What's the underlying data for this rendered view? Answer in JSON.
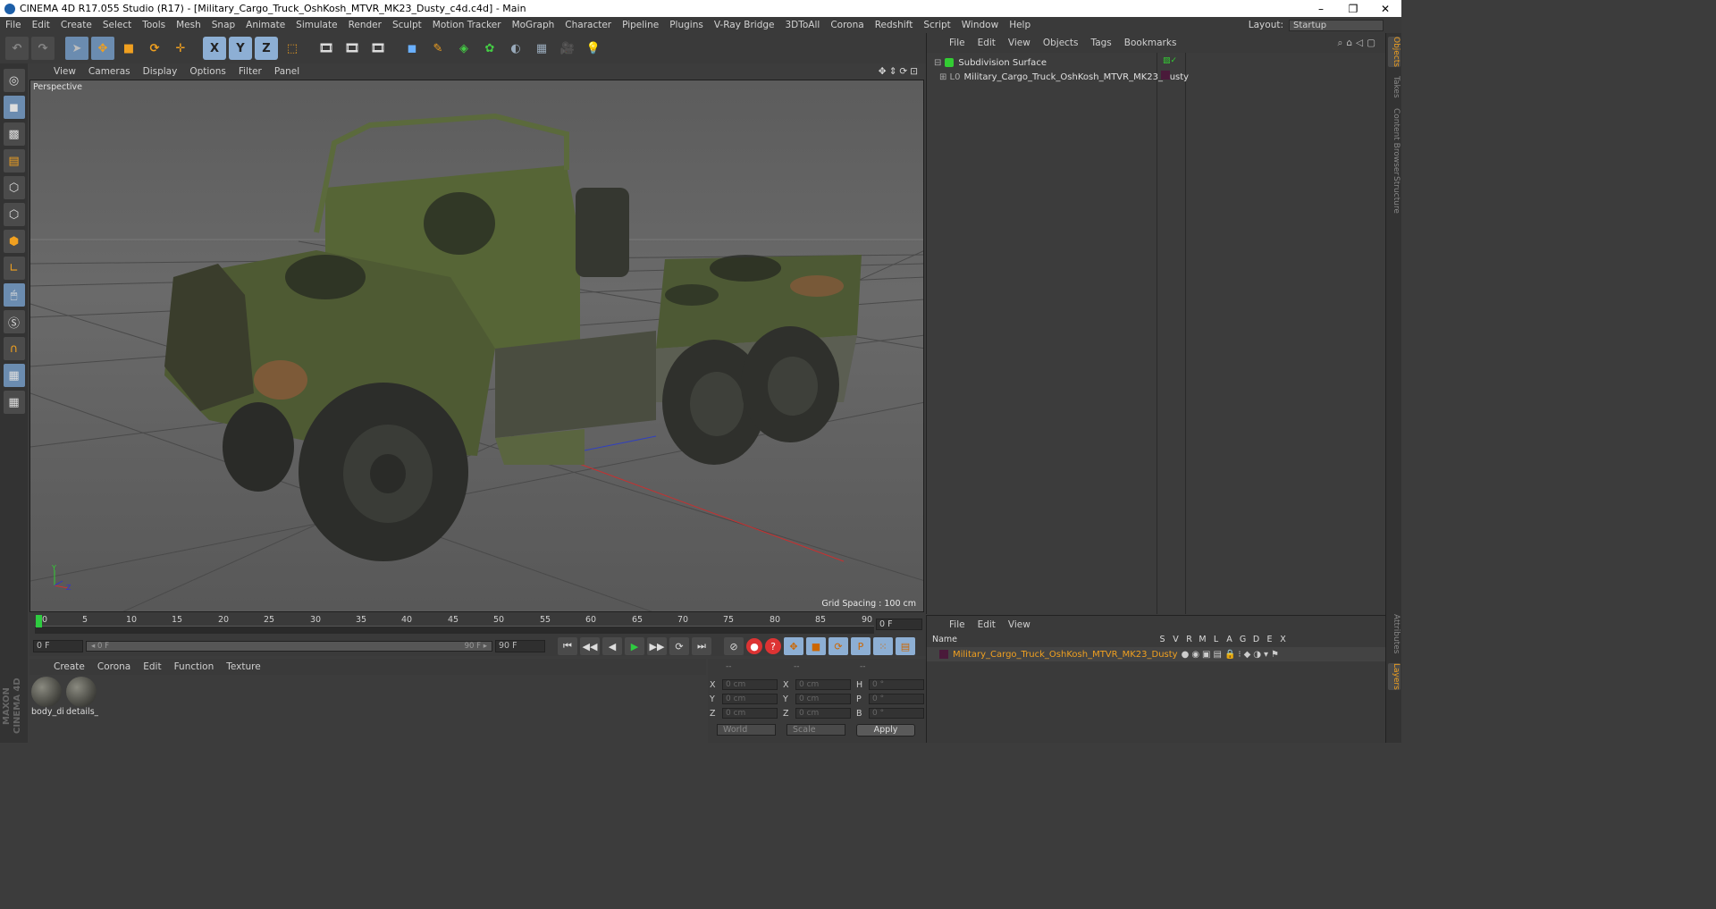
{
  "window": {
    "title": "CINEMA 4D R17.055 Studio (R17) - [Military_Cargo_Truck_OshKosh_MTVR_MK23_Dusty_c4d.c4d] - Main",
    "controls": [
      "–",
      "❐",
      "✕"
    ]
  },
  "menubar": {
    "items": [
      "File",
      "Edit",
      "Create",
      "Select",
      "Tools",
      "Mesh",
      "Snap",
      "Animate",
      "Simulate",
      "Render",
      "Sculpt",
      "Motion Tracker",
      "MoGraph",
      "Character",
      "Pipeline",
      "Plugins",
      "V-Ray Bridge",
      "3DToAll",
      "Corona",
      "Redshift",
      "Script",
      "Window",
      "Help"
    ],
    "layout_label": "Layout:",
    "layout_value": "Startup"
  },
  "toolbar": {
    "axis_x": "X",
    "axis_y": "Y",
    "axis_z": "Z"
  },
  "viewport": {
    "menu": [
      "View",
      "Cameras",
      "Display",
      "Options",
      "Filter",
      "Panel"
    ],
    "nav_icons": "✥⇕⟳⊡",
    "label": "Perspective",
    "grid_spacing": "Grid Spacing : 100 cm",
    "axis_y": "Y",
    "axis_z": "Z",
    "axis_x": "X",
    "colors": {
      "truck_green": "#5a6b3a",
      "camo_dark": "#2a2a22",
      "camo_brown": "#8a5a3a",
      "x_axis": "#c83030",
      "z_axis": "#3040c0"
    }
  },
  "timeline": {
    "ticks": [
      "0",
      "5",
      "10",
      "15",
      "20",
      "25",
      "30",
      "35",
      "40",
      "45",
      "50",
      "55",
      "60",
      "65",
      "70",
      "75",
      "80",
      "85",
      "90"
    ],
    "current_frame": "0 F"
  },
  "transport": {
    "start_field": "0 F",
    "slider_left": "◂ 0 F",
    "slider_right": "90 F ▸",
    "end_field": "90 F",
    "buttons": [
      "⏮",
      "◀◀",
      "◀",
      "▶",
      "▶▶",
      "⟳",
      "⏭"
    ]
  },
  "materials": {
    "menu": [
      "Create",
      "Corona",
      "Edit",
      "Function",
      "Texture"
    ],
    "items": [
      {
        "label": "body_di"
      },
      {
        "label": "details_"
      }
    ]
  },
  "coords": {
    "headers": [
      "--",
      "--",
      "--"
    ],
    "rows": [
      {
        "a": "X",
        "av": "0 cm",
        "b": "X",
        "bv": "0 cm",
        "c": "H",
        "cv": "0 °"
      },
      {
        "a": "Y",
        "av": "0 cm",
        "b": "Y",
        "bv": "0 cm",
        "c": "P",
        "cv": "0 °"
      },
      {
        "a": "Z",
        "av": "0 cm",
        "b": "Z",
        "bv": "0 cm",
        "c": "B",
        "cv": "0 °"
      }
    ],
    "world": "World",
    "scale": "Scale",
    "apply": "Apply"
  },
  "objects": {
    "menu": [
      "File",
      "Edit",
      "View",
      "Objects",
      "Tags",
      "Bookmarks"
    ],
    "items": [
      {
        "name": "Subdivision Surface",
        "prefix": "⊟"
      },
      {
        "name": "Military_Cargo_Truck_OshKosh_MTVR_MK23_Dusty",
        "prefix": "⊞ L0"
      }
    ]
  },
  "layers": {
    "menu": [
      "File",
      "Edit",
      "View"
    ],
    "header_name": "Name",
    "header_cols": [
      "S",
      "V",
      "R",
      "M",
      "L",
      "A",
      "G",
      "D",
      "E",
      "X"
    ],
    "row_name": "Military_Cargo_Truck_OshKosh_MTVR_MK23_Dusty"
  },
  "right_tabs": [
    "Objects",
    "Takes",
    "Content Browser",
    "Structure",
    "Attributes",
    "Layers"
  ],
  "branding": "MAXON CINEMA 4D"
}
